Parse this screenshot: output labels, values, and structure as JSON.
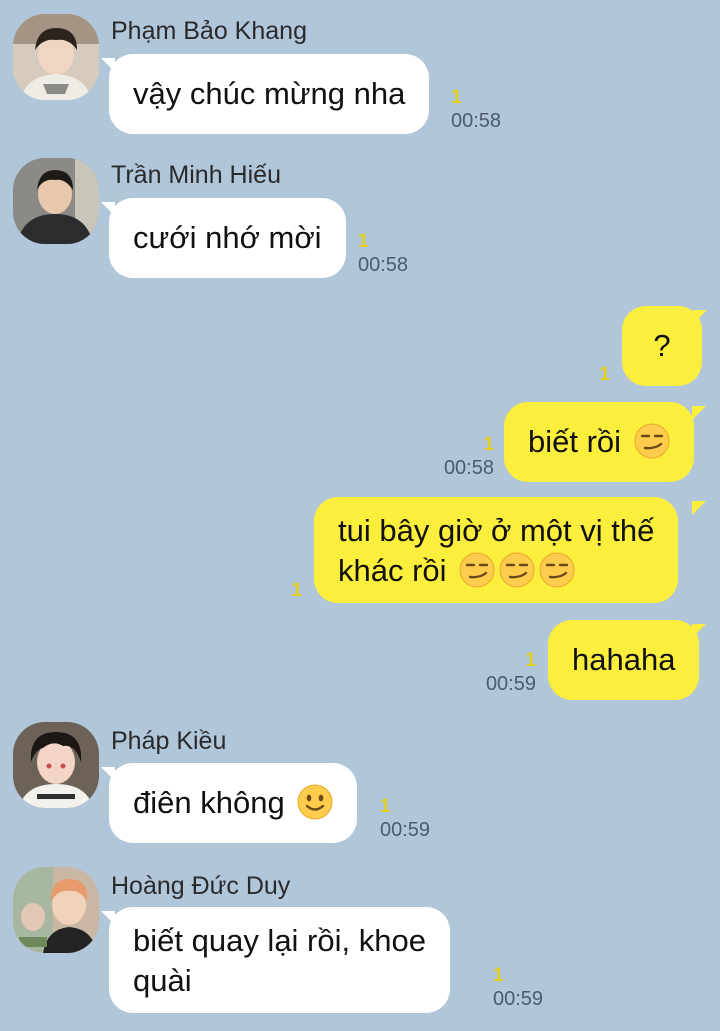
{
  "messages": [
    {
      "sender": "Phạm Bảo Khang",
      "text": "vậy chúc mừng nha",
      "unread": "1",
      "time": "00:58",
      "avatar_icon": "avatar-pham-bao-khang"
    },
    {
      "sender": "Trần Minh Hiếu",
      "text": "cưới nhớ mời",
      "unread": "1",
      "time": "00:58",
      "avatar_icon": "avatar-tran-minh-hieu"
    },
    {
      "text": "?",
      "unread": "1"
    },
    {
      "text": "biết rồi",
      "emoji": [
        "smirking-face"
      ],
      "unread": "1",
      "time": "00:58"
    },
    {
      "line1": "tui bây giờ ở một vị thế",
      "line2": "khác rồi",
      "emoji": [
        "smirking-face",
        "smirking-face",
        "smirking-face"
      ],
      "unread": "1"
    },
    {
      "text": "hahaha",
      "unread": "1",
      "time": "00:59"
    },
    {
      "sender": "Pháp Kiều",
      "text": "điên không",
      "emoji": [
        "slightly-smiling-face"
      ],
      "unread": "1",
      "time": "00:59",
      "avatar_icon": "avatar-phap-kieu"
    },
    {
      "sender": "Hoàng Đức Duy",
      "line1": "biết quay lại rồi, khoe",
      "line2": "quài",
      "unread": "1",
      "time": "00:59",
      "avatar_icon": "avatar-hoang-duc-duy"
    }
  ],
  "colors": {
    "background": "#b2c6d9",
    "incoming_bubble": "#ffffff",
    "outgoing_bubble": "#fcee3c",
    "unread_count": "#e3cf1f",
    "timestamp": "#4c5c6a"
  }
}
